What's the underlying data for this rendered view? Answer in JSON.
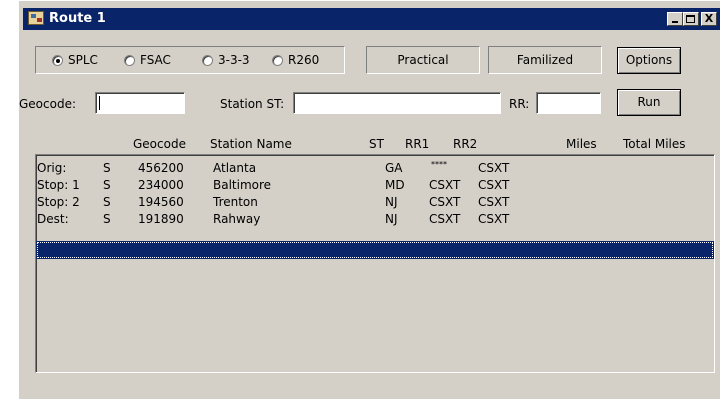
{
  "window": {
    "title": "Route 1",
    "controls": {
      "minimize": "_",
      "close": "X"
    }
  },
  "format_options": [
    {
      "label": "SPLC",
      "checked": true
    },
    {
      "label": "FSAC",
      "checked": false
    },
    {
      "label": "3-3-3",
      "checked": false
    },
    {
      "label": "R260",
      "checked": false
    }
  ],
  "mode_labels": {
    "practical": "Practical",
    "familized": "Familized"
  },
  "buttons": {
    "options": "Options",
    "run": "Run"
  },
  "inputs": {
    "geocode_label": "Geocode:",
    "geocode_value": "",
    "station_st_label": "Station ST:",
    "station_st_value": "",
    "rr_label": "RR:",
    "rr_value": ""
  },
  "columns": [
    "Geocode",
    "Station Name",
    "ST",
    "RR1",
    "RR2",
    "Miles",
    "Total Miles"
  ],
  "rows": [
    {
      "type": "Orig:",
      "flag": "S",
      "geocode": "456200",
      "station": "Atlanta",
      "st": "GA",
      "rr1": "****",
      "rr2": "CSXT"
    },
    {
      "type": "Stop: 1",
      "flag": "S",
      "geocode": "234000",
      "station": "Baltimore",
      "st": "MD",
      "rr1": "CSXT",
      "rr2": "CSXT"
    },
    {
      "type": "Stop: 2",
      "flag": "S",
      "geocode": "194560",
      "station": "Trenton",
      "st": "NJ",
      "rr1": "CSXT",
      "rr2": "CSXT"
    },
    {
      "type": "Dest:",
      "flag": "S",
      "geocode": "191890",
      "station": "Rahway",
      "st": "NJ",
      "rr1": "CSXT",
      "rr2": "CSXT"
    }
  ],
  "colors": {
    "titlebar": "#0a246a",
    "face": "#d4d0c8",
    "selection": "#0a246a"
  }
}
